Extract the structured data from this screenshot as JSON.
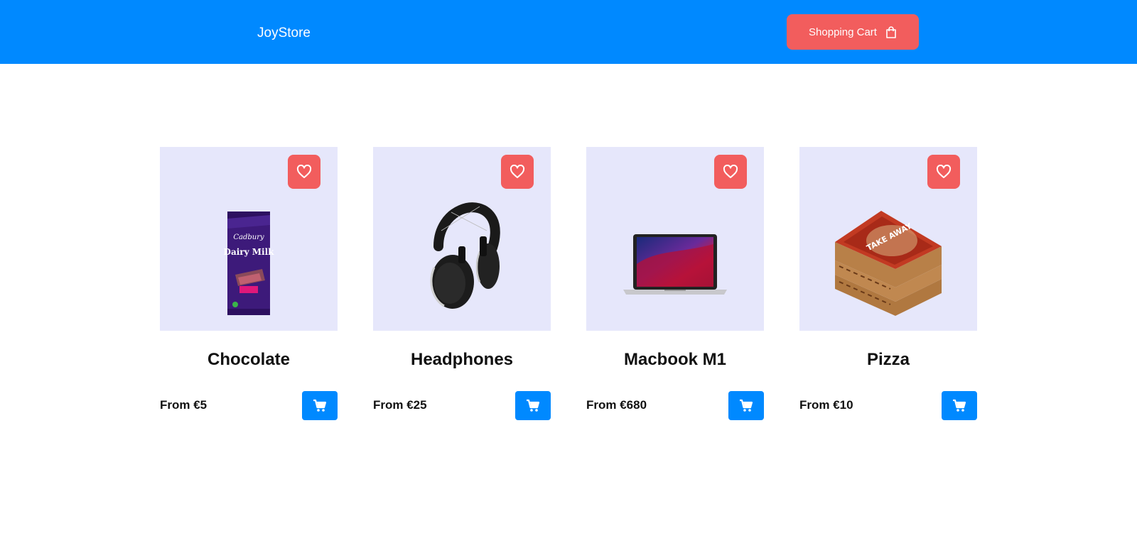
{
  "navbar": {
    "brand": "JoyStore",
    "cart_label": "Shopping Cart",
    "cart_icon": "shopping-bag-icon"
  },
  "products": [
    {
      "name": "Chocolate",
      "price": "From €5",
      "image": "chocolate-bar"
    },
    {
      "name": "Headphones",
      "price": "From €25",
      "image": "headphones"
    },
    {
      "name": "Macbook M1",
      "price": "From €680",
      "image": "laptop"
    },
    {
      "name": "Pizza",
      "price": "From €10",
      "image": "pizza-boxes"
    }
  ],
  "icons": {
    "favorite": "heart-icon",
    "add_to_cart": "cart-icon"
  },
  "colors": {
    "primary": "#0089ff",
    "accent": "#f25d5d",
    "card_bg": "#e6e7fb"
  },
  "product_art_text": {
    "chocolate_brand": "Cadbury",
    "chocolate_name": "Dairy Milk",
    "pizza_box": "TAKE AWAY"
  }
}
